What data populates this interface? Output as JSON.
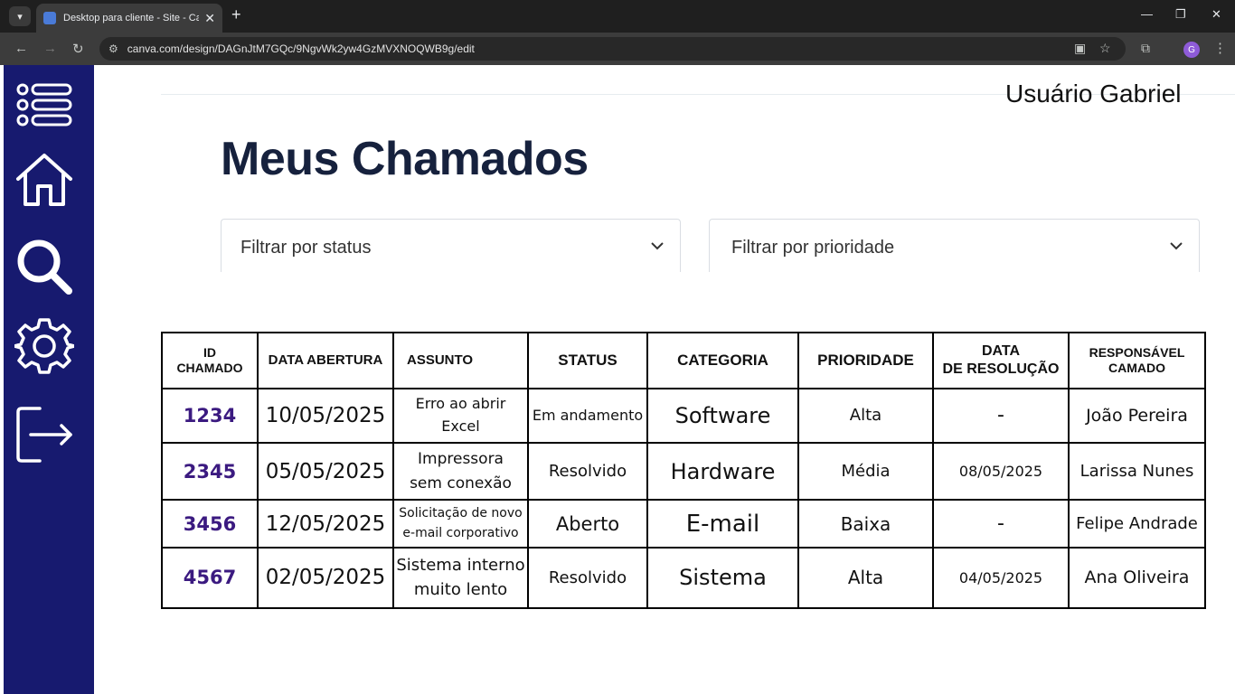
{
  "browser": {
    "tab_title": "Desktop para cliente - Site - Ca",
    "url": "canva.com/design/DAGnJtM7GQc/9NgvWk2yw4GzMVXNOQWB9g/edit",
    "profile_initial": "G"
  },
  "sidebar": {
    "items": [
      {
        "icon": "list-icon"
      },
      {
        "icon": "home-icon"
      },
      {
        "icon": "search-icon"
      },
      {
        "icon": "gear-icon"
      },
      {
        "icon": "logout-icon"
      }
    ]
  },
  "header": {
    "user_label": "Usuário Gabriel",
    "title": "Meus Chamados"
  },
  "filters": {
    "status": "Filtrar por status",
    "priority": "Filtrar por prioridade"
  },
  "table": {
    "headers": {
      "id_line1": "ID",
      "id_line2": "CHAMADO",
      "opened": "DATA ABERTURA",
      "subject": "ASSUNTO",
      "status": "STATUS",
      "category": "CATEGORIA",
      "priority": "PRIORIDADE",
      "resolved_line1": "DATA",
      "resolved_line2": "DE RESOLUÇÃO",
      "owner_line1": "RESPONSÁVEL",
      "owner_line2": "CAMADO"
    },
    "rows": [
      {
        "id": "1234",
        "opened": "10/05/2025",
        "subject_1": "Erro ao abrir Excel",
        "subject_2": "",
        "status": "Em andamento",
        "category": "Software",
        "priority": "Alta",
        "resolved": "-",
        "owner": "João Pereira"
      },
      {
        "id": "2345",
        "opened": "05/05/2025",
        "subject_1": "Impressora",
        "subject_2": "sem conexão",
        "status": "Resolvido",
        "category": "Hardware",
        "priority": "Média",
        "resolved": "08/05/2025",
        "owner": "Larissa Nunes"
      },
      {
        "id": "3456",
        "opened": "12/05/2025",
        "subject_1": "Solicitação de novo",
        "subject_2": "e-mail corporativo",
        "status": "Aberto",
        "category": "E-mail",
        "priority": "Baixa",
        "resolved": "-",
        "owner": "Felipe Andrade"
      },
      {
        "id": "4567",
        "opened": "02/05/2025",
        "subject_1": "Sistema interno",
        "subject_2": "muito lento",
        "status": "Resolvido",
        "category": "Sistema",
        "priority": "Alta",
        "resolved": "04/05/2025",
        "owner": "Ana Oliveira"
      }
    ]
  }
}
